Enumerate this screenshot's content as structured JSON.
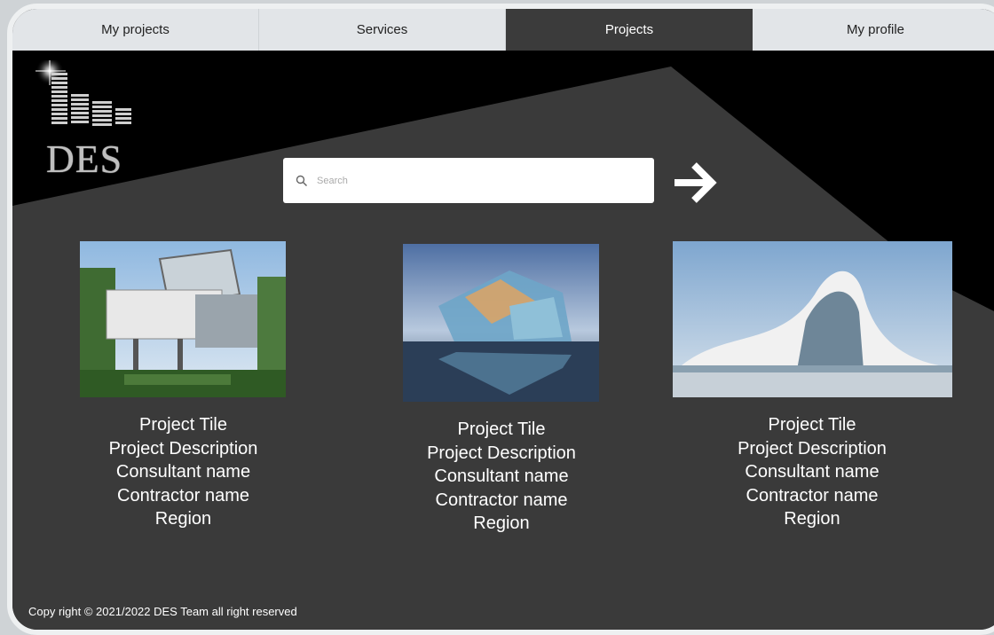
{
  "nav": {
    "tabs": [
      {
        "label": "My projects"
      },
      {
        "label": "Services"
      },
      {
        "label": "Projects"
      },
      {
        "label": "My profile"
      }
    ],
    "active": "Projects"
  },
  "logo": {
    "text": "DES"
  },
  "search": {
    "placeholder": "Search"
  },
  "projects": [
    {
      "title": "Project Tile",
      "description": "Project Description",
      "consultant": "Consultant name",
      "contractor": "Contractor name",
      "region": "Region"
    },
    {
      "title": "Project Tile",
      "description": "Project Description",
      "consultant": "Consultant name",
      "contractor": "Contractor name",
      "region": "Region"
    },
    {
      "title": "Project Tile",
      "description": "Project Description",
      "consultant": "Consultant name",
      "contractor": "Contractor name",
      "region": "Region"
    }
  ],
  "footer": {
    "text": "Copy right © 2021/2022  DES Team all right reserved"
  },
  "colors": {
    "background": "#3a3a3a",
    "nav_active": "#3b3b3b",
    "nav": "#e2e5e8",
    "black_band": "#000000"
  }
}
